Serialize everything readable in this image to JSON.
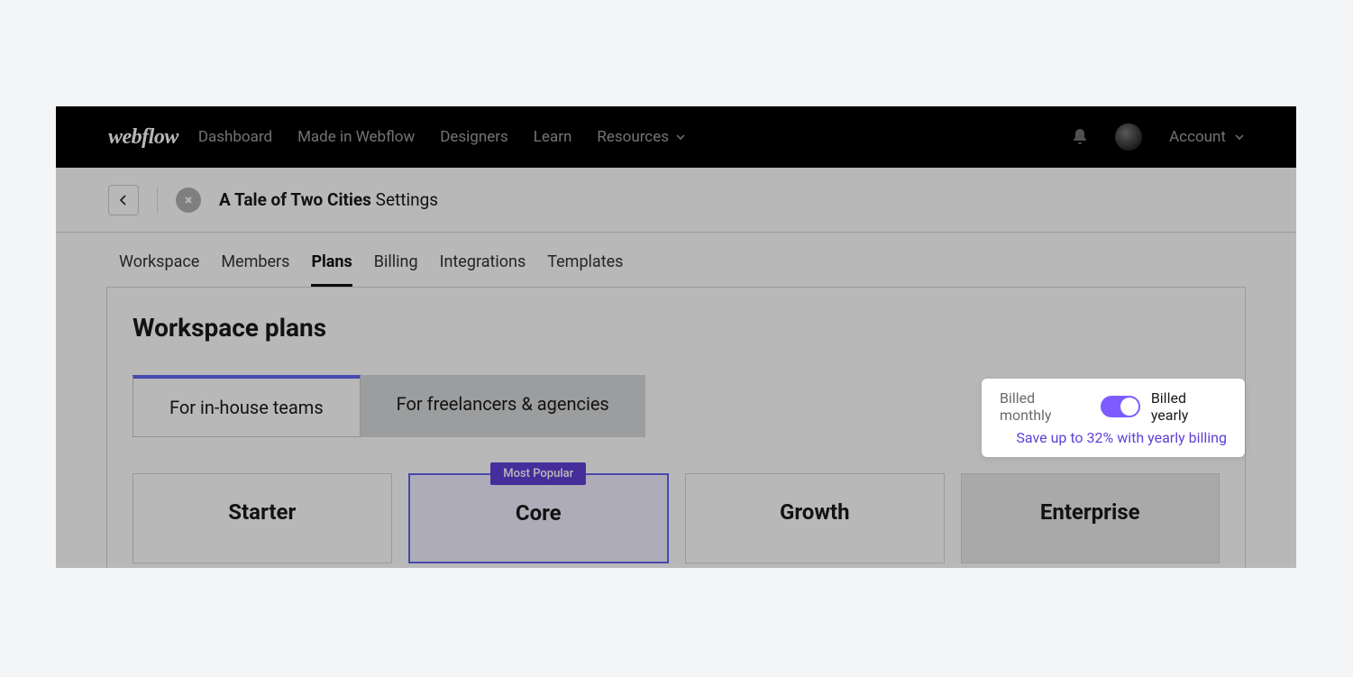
{
  "logo": "webflow",
  "nav": {
    "dashboard": "Dashboard",
    "made": "Made in Webflow",
    "designers": "Designers",
    "learn": "Learn",
    "resources": "Resources",
    "account": "Account"
  },
  "header": {
    "workspace_name": "A Tale of Two Cities",
    "settings_label": "Settings"
  },
  "tabs": {
    "workspace": "Workspace",
    "members": "Members",
    "plans": "Plans",
    "billing": "Billing",
    "integrations": "Integrations",
    "templates": "Templates"
  },
  "section": {
    "title": "Workspace plans"
  },
  "audience_tabs": {
    "inhouse": "For in-house teams",
    "freelancers": "For freelancers & agencies"
  },
  "billing": {
    "monthly": "Billed monthly",
    "yearly": "Billed yearly",
    "savings": "Save up to 32% with yearly billing"
  },
  "plans": {
    "starter": "Starter",
    "core": "Core",
    "growth": "Growth",
    "enterprise": "Enterprise",
    "badge": "Most Popular"
  }
}
